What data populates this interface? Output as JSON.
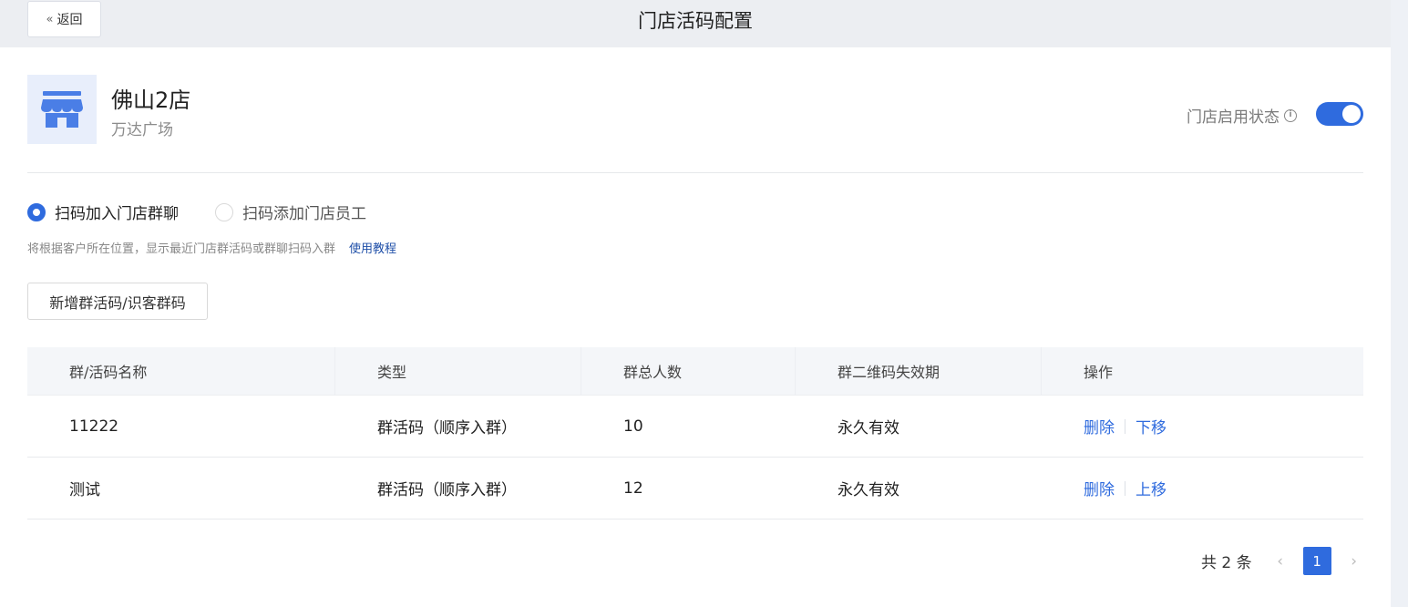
{
  "header": {
    "back_label": "返回",
    "title": "门店活码配置"
  },
  "store": {
    "name": "佛山2店",
    "subtitle": "万达广场",
    "status_label": "门店启用状态",
    "enabled": true
  },
  "mode": {
    "options": [
      {
        "label": "扫码加入门店群聊",
        "checked": true
      },
      {
        "label": "扫码添加门店员工",
        "checked": false
      }
    ],
    "hint": "将根据客户所在位置，显示最近门店群活码或群聊扫码入群",
    "hint_link": "使用教程"
  },
  "add_button": "新增群活码/识客群码",
  "table": {
    "columns": [
      "群/活码名称",
      "类型",
      "群总人数",
      "群二维码失效期",
      "操作"
    ],
    "rows": [
      {
        "name": "11222",
        "type": "群活码（顺序入群）",
        "count": "10",
        "expiry": "永久有效",
        "ops": [
          "删除",
          "下移"
        ]
      },
      {
        "name": "测试",
        "type": "群活码（顺序入群）",
        "count": "12",
        "expiry": "永久有效",
        "ops": [
          "删除",
          "上移"
        ]
      }
    ]
  },
  "pagination": {
    "total_label": "共 2 条",
    "current_page": "1"
  },
  "colors": {
    "primary": "#2f6bde",
    "header_bg": "#eceef2",
    "icon_bg": "#e8eefb"
  }
}
